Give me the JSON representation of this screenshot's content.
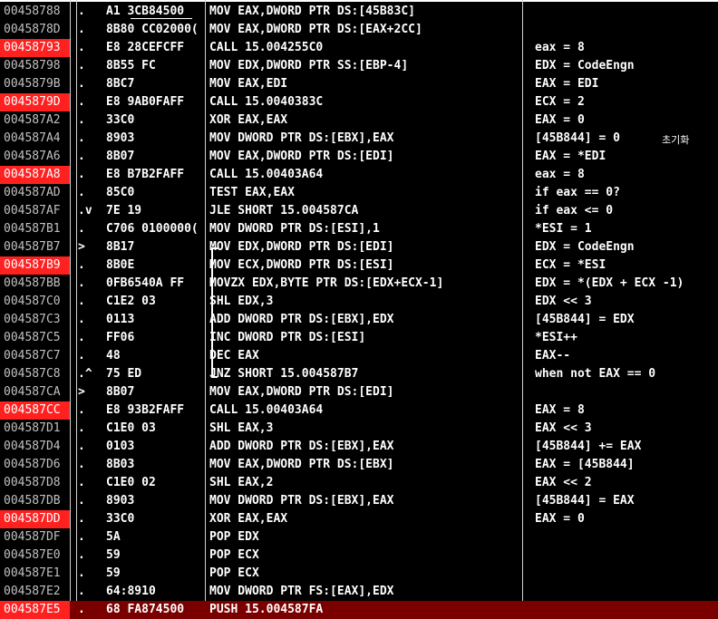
{
  "rows": [
    {
      "addr": "00458788",
      "bp": false,
      "mark": ".",
      "hex": "A1 3CB84500",
      "asm": "MOV EAX,DWORD PTR DS:[45B83C]",
      "comment": ""
    },
    {
      "addr": "0045878D",
      "bp": false,
      "mark": ".",
      "hex": "8B80 CC02000(",
      "asm": "MOV EAX,DWORD PTR DS:[EAX+2CC]",
      "comment": ""
    },
    {
      "addr": "00458793",
      "bp": true,
      "mark": ".",
      "hex": "E8 28CEFCFF",
      "asm": "CALL 15.004255C0",
      "comment": "eax = 8"
    },
    {
      "addr": "00458798",
      "bp": false,
      "mark": ".",
      "hex": "8B55 FC",
      "asm": "MOV EDX,DWORD PTR SS:[EBP-4]",
      "comment": "EDX = CodeEngn"
    },
    {
      "addr": "0045879B",
      "bp": false,
      "mark": ".",
      "hex": "8BC7",
      "asm": "MOV EAX,EDI",
      "comment": "EAX = EDI"
    },
    {
      "addr": "0045879D",
      "bp": true,
      "mark": ".",
      "hex": "E8 9AB0FAFF",
      "asm": "CALL 15.0040383C",
      "comment": "ECX = 2"
    },
    {
      "addr": "004587A2",
      "bp": false,
      "mark": ".",
      "hex": "33C0",
      "asm": "XOR EAX,EAX",
      "comment": "EAX = 0"
    },
    {
      "addr": "004587A4",
      "bp": false,
      "mark": ".",
      "hex": "8903",
      "asm": "MOV DWORD PTR DS:[EBX],EAX",
      "comment": "[45B844] = 0"
    },
    {
      "addr": "004587A6",
      "bp": false,
      "mark": ".",
      "hex": "8B07",
      "asm": "MOV EAX,DWORD PTR DS:[EDI]",
      "comment": "EAX = *EDI"
    },
    {
      "addr": "004587A8",
      "bp": true,
      "mark": ".",
      "hex": "E8 B7B2FAFF",
      "asm": "CALL 15.00403A64",
      "comment": "eax = 8"
    },
    {
      "addr": "004587AD",
      "bp": false,
      "mark": ".",
      "hex": "85C0",
      "asm": "TEST EAX,EAX",
      "comment": "if eax == 0?"
    },
    {
      "addr": "004587AF",
      "bp": false,
      "mark": ".v",
      "hex": "7E 19",
      "asm": "JLE SHORT 15.004587CA",
      "comment": "if eax <= 0"
    },
    {
      "addr": "004587B1",
      "bp": false,
      "mark": ".",
      "hex": "C706 0100000(",
      "asm": "MOV DWORD PTR DS:[ESI],1",
      "comment": "*ESI = 1"
    },
    {
      "addr": "004587B7",
      "bp": false,
      "mark": ">",
      "hex": "8B17",
      "asm": "MOV EDX,DWORD PTR DS:[EDI]",
      "comment": "EDX = CodeEngn"
    },
    {
      "addr": "004587B9",
      "bp": true,
      "mark": ".",
      "hex": "8B0E",
      "asm": "MOV ECX,DWORD PTR DS:[ESI]",
      "comment": "ECX = *ESI"
    },
    {
      "addr": "004587BB",
      "bp": false,
      "mark": ".",
      "hex": "0FB6540A FF",
      "asm": "MOVZX EDX,BYTE PTR DS:[EDX+ECX-1]",
      "comment": "EDX = *(EDX + ECX -1)"
    },
    {
      "addr": "004587C0",
      "bp": false,
      "mark": ".",
      "hex": "C1E2 03",
      "asm": "SHL EDX,3",
      "comment": "EDX << 3"
    },
    {
      "addr": "004587C3",
      "bp": false,
      "mark": ".",
      "hex": "0113",
      "asm": "ADD DWORD PTR DS:[EBX],EDX",
      "comment": "[45B844] = EDX"
    },
    {
      "addr": "004587C5",
      "bp": false,
      "mark": ".",
      "hex": "FF06",
      "asm": "INC DWORD PTR DS:[ESI]",
      "comment": "*ESI++"
    },
    {
      "addr": "004587C7",
      "bp": false,
      "mark": ".",
      "hex": "48",
      "asm": "DEC EAX",
      "comment": "EAX--"
    },
    {
      "addr": "004587C8",
      "bp": false,
      "mark": ".^",
      "hex": "75 ED",
      "asm": "JNZ SHORT 15.004587B7",
      "comment": "when not EAX == 0"
    },
    {
      "addr": "004587CA",
      "bp": false,
      "mark": ">",
      "hex": "8B07",
      "asm": "MOV EAX,DWORD PTR DS:[EDI]",
      "comment": ""
    },
    {
      "addr": "004587CC",
      "bp": true,
      "mark": ".",
      "hex": "E8 93B2FAFF",
      "asm": "CALL 15.00403A64",
      "comment": "EAX =  8"
    },
    {
      "addr": "004587D1",
      "bp": false,
      "mark": ".",
      "hex": "C1E0 03",
      "asm": "SHL EAX,3",
      "comment": "EAX << 3"
    },
    {
      "addr": "004587D4",
      "bp": false,
      "mark": ".",
      "hex": "0103",
      "asm": "ADD DWORD PTR DS:[EBX],EAX",
      "comment": "[45B844] += EAX"
    },
    {
      "addr": "004587D6",
      "bp": false,
      "mark": ".",
      "hex": "8B03",
      "asm": "MOV EAX,DWORD PTR DS:[EBX]",
      "comment": "EAX = [45B844]"
    },
    {
      "addr": "004587D8",
      "bp": false,
      "mark": ".",
      "hex": "C1E0 02",
      "asm": "SHL EAX,2",
      "comment": "EAX << 2"
    },
    {
      "addr": "004587DB",
      "bp": false,
      "mark": ".",
      "hex": "8903",
      "asm": "MOV DWORD PTR DS:[EBX],EAX",
      "comment": "[45B844] = EAX"
    },
    {
      "addr": "004587DD",
      "bp": true,
      "mark": ".",
      "hex": "33C0",
      "asm": "XOR EAX,EAX",
      "comment": "EAX = 0"
    },
    {
      "addr": "004587DF",
      "bp": false,
      "mark": ".",
      "hex": "5A",
      "asm": "POP EDX",
      "comment": ""
    },
    {
      "addr": "004587E0",
      "bp": false,
      "mark": ".",
      "hex": "59",
      "asm": "POP ECX",
      "comment": ""
    },
    {
      "addr": "004587E1",
      "bp": false,
      "mark": ".",
      "hex": "59",
      "asm": "POP ECX",
      "comment": ""
    },
    {
      "addr": "004587E2",
      "bp": false,
      "mark": ".",
      "hex": "64:8910",
      "asm": "MOV DWORD PTR FS:[EAX],EDX",
      "comment": ""
    },
    {
      "addr": "004587E5",
      "bp": true,
      "mark": ".",
      "hex": "68 FA874500",
      "asm": "PUSH 15.004587FA",
      "comment": "",
      "current": true
    }
  ],
  "side_note": "초기화",
  "colors": {
    "breakpoint": "#ff2020",
    "background": "#000000",
    "current_line": "#7a0000"
  }
}
